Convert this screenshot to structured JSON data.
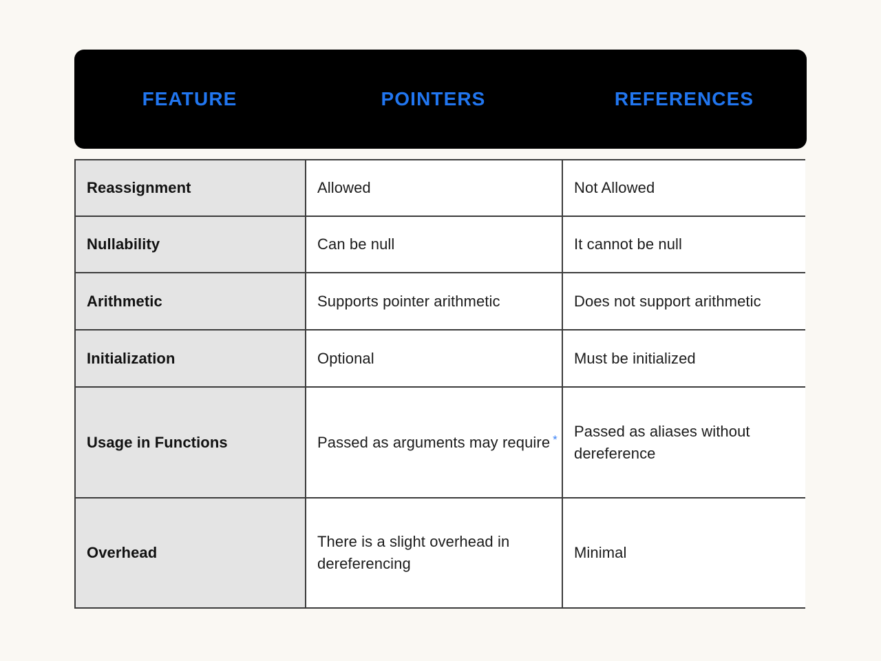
{
  "page": {
    "background_color": "#faf8f3",
    "accent_color": "#2176f0",
    "asterisk_color": "#3b82f6",
    "header_background": "#000000",
    "feature_column_background": "#e4e4e4",
    "border_color": "#3b3b3b"
  },
  "header": {
    "columns": [
      {
        "label": "FEATURE"
      },
      {
        "label": "POINTERS"
      },
      {
        "label": "REFERENCES"
      }
    ]
  },
  "table": {
    "rows": [
      {
        "feature": "Reassignment",
        "pointers": "Allowed",
        "references": "Not Allowed"
      },
      {
        "feature": "Nullability",
        "pointers": "Can be null",
        "references": "It cannot be null"
      },
      {
        "feature": "Arithmetic",
        "pointers": "Supports pointer arithmetic",
        "references": "Does not support arithmetic"
      },
      {
        "feature": "Initialization",
        "pointers": "Optional",
        "references": "Must be initialized"
      },
      {
        "feature": "Usage in Functions",
        "pointers": "Passed as arguments may require",
        "pointers_suffix": "*",
        "references": "Passed as aliases without dereference"
      },
      {
        "feature": "Overhead",
        "pointers": "There is a slight overhead in dereferencing",
        "references": "Minimal"
      }
    ]
  }
}
